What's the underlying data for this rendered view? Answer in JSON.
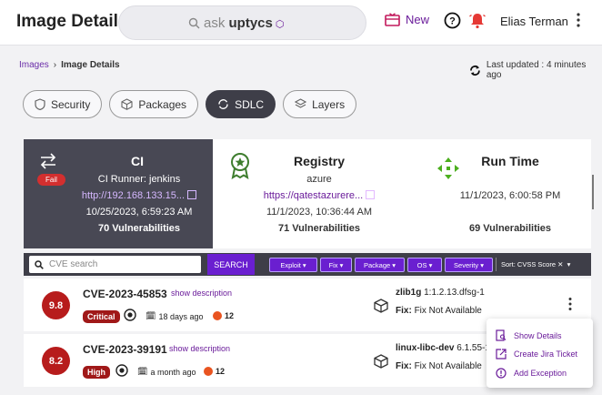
{
  "header": {
    "title": "Image Details",
    "search_prefix": "ask ",
    "search_brand": "uptycs",
    "new_label": "New",
    "user_name": "Elias Terman"
  },
  "breadcrumb": {
    "root": "Images",
    "sep": "›",
    "current": "Image Details"
  },
  "last_updated": "Last updated : 4 minutes ago",
  "tabs": [
    {
      "label": "Security",
      "active": false
    },
    {
      "label": "Packages",
      "active": false
    },
    {
      "label": "SDLC",
      "active": true
    },
    {
      "label": "Layers",
      "active": false
    }
  ],
  "ci": {
    "title": "CI",
    "status": "Fail",
    "runner": "CI Runner: jenkins",
    "url": "http://192.168.133.15...",
    "timestamp": "10/25/2023, 6:59:23 AM",
    "vulns": "70 Vulnerabilities"
  },
  "registry": {
    "title": "Registry",
    "provider": "azure",
    "url": "https://qatestazurere...",
    "timestamp": "11/1/2023, 10:36:44 AM",
    "vulns": "71 Vulnerabilities"
  },
  "runtime": {
    "title": "Run Time",
    "timestamp": "11/1/2023, 6:00:58 PM",
    "vulns": "69 Vulnerabilities"
  },
  "filters": {
    "cve_placeholder": "CVE search",
    "search_label": "SEARCH",
    "buttons": [
      "Exploit",
      "Fix",
      "Package",
      "OS",
      "Severity"
    ],
    "sort_label": "Sort: CVSS Score"
  },
  "rows": [
    {
      "score": "9.8",
      "cve": "CVE-2023-45853",
      "show": "show description",
      "severity": "Critical",
      "age": "18 days ago",
      "count": "12",
      "pkg_name": "zlib1g",
      "pkg_ver": "1:1.2.13.dfsg-1",
      "fix_label": "Fix:",
      "fix_value": "Fix Not Available"
    },
    {
      "score": "8.2",
      "cve": "CVE-2023-39191",
      "show": "show description",
      "severity": "High",
      "age": "a month ago",
      "count": "12",
      "pkg_name": "linux-libc-dev",
      "pkg_ver": "6.1.55-1",
      "fix_label": "Fix:",
      "fix_value": "Fix Not Available"
    }
  ],
  "menu": {
    "items": [
      {
        "label": "Show Details",
        "icon": "details-icon"
      },
      {
        "label": "Create Jira Ticket",
        "icon": "external-link-icon"
      },
      {
        "label": "Add Exception",
        "icon": "alert-icon"
      }
    ]
  },
  "colors": {
    "accent": "#6a1fd0",
    "fail": "#d32f2f",
    "critical": "#a01818",
    "dark_panel": "#484854"
  }
}
